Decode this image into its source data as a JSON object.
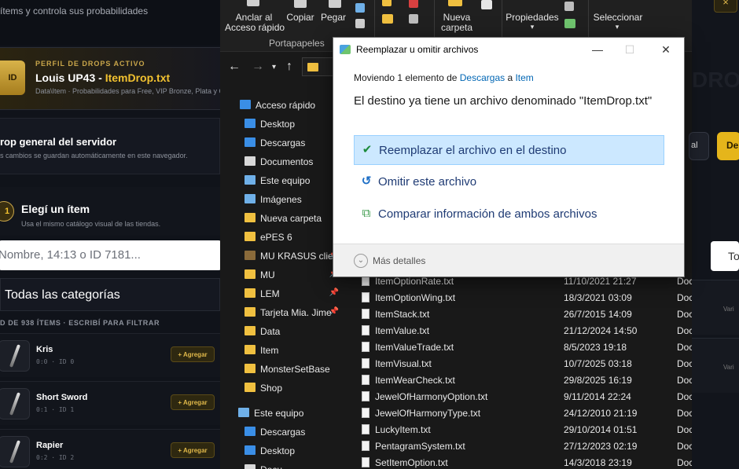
{
  "webapp": {
    "subtitle": "ítems y controla sus probabilidades",
    "profile": {
      "badge": "ID",
      "kicker": "PERFIL DE DROPS ACTIVO",
      "name": "Louis UP43 - ",
      "file": "ItemDrop.txt",
      "path": "Data\\Item · Probabilidades para Free, VIP Bronze, Plata y O"
    },
    "drop_section": {
      "heading": "rop general del servidor",
      "desc": "s cambios se guardan automáticamente en este navegador."
    },
    "step": {
      "number": "1",
      "heading": "Elegí un ítem",
      "desc": "Usa el mismo catálogo visual de las tiendas."
    },
    "search_placeholder": "Nombre, 14:13 o ID 7181...",
    "category": "Todas las categorías",
    "count_hint": "D DE 938 ÍTEMS · ESCRIBÍ PARA FILTRAR",
    "items": [
      {
        "name": "Kris",
        "id": "0:0 · ID 0",
        "action": "+ Agregar"
      },
      {
        "name": "Short Sword",
        "id": "0:1 · ID 1",
        "action": "+ Agregar"
      },
      {
        "name": "Rapier",
        "id": "0:2 · ID 2",
        "action": "+ Agregar"
      }
    ]
  },
  "explorer": {
    "ribbon": {
      "pin_label": "Anclar al\nAcceso rápido",
      "copy": "Copiar",
      "paste": "Pegar",
      "new_folder": "Nueva\ncarpeta",
      "properties": "Propiedades",
      "select": "Seleccionar",
      "group_clipboard": "Portapapeles"
    },
    "sidebar": [
      {
        "label": "Acceso rápido",
        "icon": "star-icon",
        "color": "#3a8ee6"
      },
      {
        "label": "Desktop",
        "icon": "desktop-icon",
        "color": "#3a8ee6"
      },
      {
        "label": "Descargas",
        "icon": "download-icon",
        "color": "#3a8ee6"
      },
      {
        "label": "Documentos",
        "icon": "document-icon",
        "color": "#d8d8d8"
      },
      {
        "label": "Este equipo",
        "icon": "computer-icon",
        "color": "#6fb0e8"
      },
      {
        "label": "Imágenes",
        "icon": "image-icon",
        "color": "#6fb0e8"
      },
      {
        "label": "Nueva carpeta",
        "icon": "folder-icon",
        "color": "#f0c040"
      },
      {
        "label": "ePES 6",
        "icon": "folder-icon",
        "color": "#f0c040"
      },
      {
        "label": "MU KRASUS clier",
        "icon": "app-icon",
        "color": "#8a6a3a"
      },
      {
        "label": "MU",
        "icon": "folder-icon",
        "color": "#f0c040"
      },
      {
        "label": "LEM",
        "icon": "folder-icon",
        "color": "#f0c040"
      },
      {
        "label": "Tarjeta Mia. Jime",
        "icon": "folder-icon",
        "color": "#f0c040"
      },
      {
        "label": "Data",
        "icon": "folder-icon",
        "color": "#f0c040"
      },
      {
        "label": "Item",
        "icon": "folder-icon",
        "color": "#f0c040"
      },
      {
        "label": "MonsterSetBase",
        "icon": "folder-icon",
        "color": "#f0c040"
      },
      {
        "label": "Shop",
        "icon": "folder-icon",
        "color": "#f0c040"
      },
      {
        "label": "Este equipo",
        "icon": "computer-icon",
        "color": "#6fb0e8"
      },
      {
        "label": "Descargas",
        "icon": "download-icon",
        "color": "#3a8ee6"
      },
      {
        "label": "Desktop",
        "icon": "desktop-icon",
        "color": "#3a8ee6"
      },
      {
        "label": "Docu...",
        "icon": "document-icon",
        "color": "#d8d8d8"
      }
    ],
    "files": [
      {
        "name": "ItemOptionRate.txt",
        "date": "11/10/2021 21:27",
        "type": "Doc"
      },
      {
        "name": "ItemOptionWing.txt",
        "date": "18/3/2021 03:09",
        "type": "Doc"
      },
      {
        "name": "ItemStack.txt",
        "date": "26/7/2015 14:09",
        "type": "Doc"
      },
      {
        "name": "ItemValue.txt",
        "date": "21/12/2024 14:50",
        "type": "Doc"
      },
      {
        "name": "ItemValueTrade.txt",
        "date": "8/5/2023 19:18",
        "type": "Doc"
      },
      {
        "name": "ItemVisual.txt",
        "date": "10/7/2025 03:18",
        "type": "Doc"
      },
      {
        "name": "ItemWearCheck.txt",
        "date": "29/8/2025 16:19",
        "type": "Doc"
      },
      {
        "name": "JewelOfHarmonyOption.txt",
        "date": "9/11/2014 22:24",
        "type": "Doc"
      },
      {
        "name": "JewelOfHarmonyType.txt",
        "date": "24/12/2010 21:19",
        "type": "Doc"
      },
      {
        "name": "LuckyItem.txt",
        "date": "29/10/2014 01:51",
        "type": "Doc"
      },
      {
        "name": "PentagramSystem.txt",
        "date": "27/12/2023 02:19",
        "type": "Doc"
      },
      {
        "name": "SetItemOption.txt",
        "date": "14/3/2018 23:19",
        "type": "Doc"
      }
    ]
  },
  "dialog": {
    "title": "Reemplazar u omitir archivos",
    "moving_prefix": "Moviendo 1 elemento de ",
    "source": "Descargas",
    "moving_mid": " a ",
    "target": "Item",
    "message": "El destino ya tiene un archivo denominado \"ItemDrop.txt\"",
    "options": [
      {
        "label": "Reemplazar el archivo en el destino",
        "icon": "checkmark-icon",
        "selected": true
      },
      {
        "label": "Omitir este archivo",
        "icon": "skip-icon",
        "selected": false
      },
      {
        "label": "Comparar información de ambos archivos",
        "icon": "compare-icon",
        "selected": false
      }
    ],
    "more_details": "Más detalles"
  },
  "right": {
    "close": "×",
    "gold_btn": "De",
    "dark_btn": "al",
    "input_text": "To",
    "panel_text": "Vari",
    "watermark": "DROP"
  }
}
